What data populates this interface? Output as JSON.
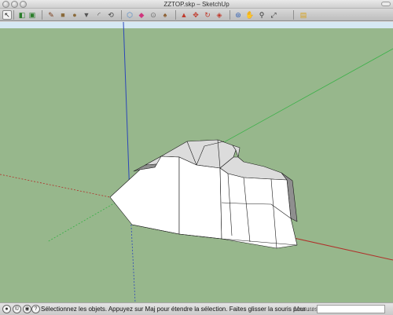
{
  "window": {
    "title": "ZZTOP.skp – SketchUp"
  },
  "toolbar": {
    "tools": [
      {
        "name": "select-tool",
        "icon": "arrow-icon",
        "glyph": "↖",
        "active": true
      },
      {
        "name": "components-tool",
        "icon": "components-icon",
        "glyph": "◧"
      },
      {
        "name": "paint-bucket-tool",
        "icon": "paint-icon",
        "glyph": "▣"
      },
      {
        "name": "pencil-tool",
        "icon": "pencil-icon",
        "glyph": "✎"
      },
      {
        "name": "rectangle-tool",
        "icon": "rectangle-icon",
        "glyph": "■"
      },
      {
        "name": "circle-tool",
        "icon": "circle-icon",
        "glyph": "●"
      },
      {
        "name": "polygon-tool",
        "icon": "polygon-icon",
        "glyph": "▼"
      },
      {
        "name": "arc-tool",
        "icon": "arc-icon",
        "glyph": "◜"
      },
      {
        "name": "freehand-tool",
        "icon": "freehand-icon",
        "glyph": "⟲"
      },
      {
        "name": "make-component-tool",
        "icon": "make-component-icon",
        "glyph": "⬡"
      },
      {
        "name": "eraser-tool",
        "icon": "eraser-icon",
        "glyph": "◆"
      },
      {
        "name": "tape-measure-tool",
        "icon": "tape-icon",
        "glyph": "⊙"
      },
      {
        "name": "bucket-tool",
        "icon": "bucket-icon",
        "glyph": "♠"
      },
      {
        "name": "push-pull-tool",
        "icon": "push-pull-icon",
        "glyph": "▲"
      },
      {
        "name": "move-tool",
        "icon": "move-icon",
        "glyph": "✥"
      },
      {
        "name": "rotate-tool",
        "icon": "rotate-icon",
        "glyph": "↻"
      },
      {
        "name": "offset-tool",
        "icon": "offset-icon",
        "glyph": "◈"
      },
      {
        "name": "orbit-tool",
        "icon": "orbit-icon",
        "glyph": "⊛"
      },
      {
        "name": "pan-tool",
        "icon": "pan-icon",
        "glyph": "✋"
      },
      {
        "name": "zoom-tool",
        "icon": "zoom-icon",
        "glyph": "⚲"
      },
      {
        "name": "zoom-extents-tool",
        "icon": "zoom-extents-icon",
        "glyph": "⤢"
      },
      {
        "name": "get-models-tool",
        "icon": "warehouse-icon",
        "glyph": "▤"
      }
    ]
  },
  "colors": {
    "sky": "#d6e8f3",
    "ground": "#97b78c",
    "axis_red": "#b0302a",
    "axis_green": "#3db14a",
    "axis_blue": "#2b46b8",
    "model_light": "#ffffff",
    "model_mid": "#dcdcdc",
    "model_dark": "#8f8f8f"
  },
  "status": {
    "message": "Sélectionnez les objets. Appuyez sur Maj pour étendre la sélection. Faites glisser la souris pour ...",
    "measure_label": "Mesures",
    "measure_value": ""
  }
}
